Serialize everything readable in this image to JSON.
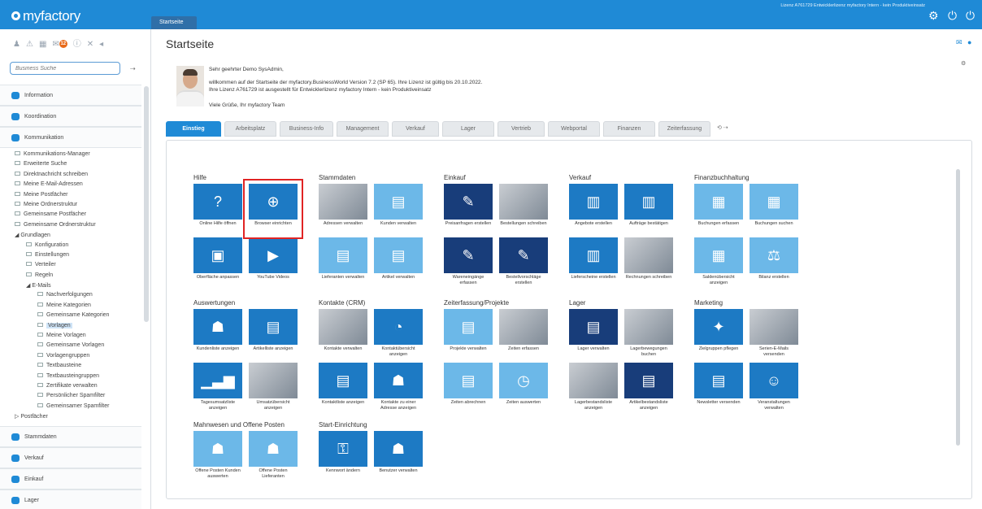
{
  "app": {
    "brand": "myfactory",
    "tab": "Startseite",
    "license": "Lizenz A761729 Entwicklerlizenz myfactory Intern - kein Produktiveinsatz",
    "icons": [
      "gear-icon",
      "power-icon",
      "power-alt-icon"
    ]
  },
  "sidebar": {
    "badge": "12",
    "search_placeholder": "Business Suche",
    "nav_top": [
      {
        "label": "Information"
      },
      {
        "label": "Koordination"
      },
      {
        "label": "Kommunikation"
      }
    ],
    "tree": [
      {
        "label": "Kommunikations-Manager",
        "lvl": 0
      },
      {
        "label": "Erweiterte Suche",
        "lvl": 0
      },
      {
        "label": "Direktnachricht schreiben",
        "lvl": 0
      },
      {
        "label": "Meine E-Mail-Adressen",
        "lvl": 0
      },
      {
        "label": "Meine Postfächer",
        "lvl": 0
      },
      {
        "label": "Meine Ordnerstruktur",
        "lvl": 0
      },
      {
        "label": "Gemeinsame Postfächer",
        "lvl": 0
      },
      {
        "label": "Gemeinsame Ordnerstruktur",
        "lvl": 0
      },
      {
        "label": "◢ Grundlagen",
        "lvl": 0,
        "folder": true
      },
      {
        "label": "Konfiguration",
        "lvl": 1
      },
      {
        "label": "Einstellungen",
        "lvl": 1
      },
      {
        "label": "Verteiler",
        "lvl": 1
      },
      {
        "label": "Regeln",
        "lvl": 1
      },
      {
        "label": "◢ E-Mails",
        "lvl": 1,
        "folder": true
      },
      {
        "label": "Nachverfolgungen",
        "lvl": 2
      },
      {
        "label": "Meine Kategorien",
        "lvl": 2
      },
      {
        "label": "Gemeinsame Kategorien",
        "lvl": 2
      },
      {
        "label": "Vorlagen",
        "lvl": 2,
        "sel": true
      },
      {
        "label": "Meine Vorlagen",
        "lvl": 2
      },
      {
        "label": "Gemeinsame Vorlagen",
        "lvl": 2
      },
      {
        "label": "Vorlagengruppen",
        "lvl": 2
      },
      {
        "label": "Textbausteine",
        "lvl": 2
      },
      {
        "label": "Textbausteingruppen",
        "lvl": 2
      },
      {
        "label": "Zertifikate verwalten",
        "lvl": 2
      },
      {
        "label": "Persönlicher Spamfilter",
        "lvl": 2
      },
      {
        "label": "Gemeinsamer Spamfilter",
        "lvl": 2
      },
      {
        "label": "▷ Postfächer",
        "lvl": 0,
        "folder": true
      }
    ],
    "nav_bottom": [
      {
        "label": "Stammdaten"
      },
      {
        "label": "Verkauf"
      },
      {
        "label": "Einkauf"
      },
      {
        "label": "Lager"
      }
    ]
  },
  "main": {
    "title": "Startseite",
    "welcome": [
      "Sehr geehrter Demo SysAdmin,",
      "willkommen auf der Startseite der myfactory.BusinessWorld Version 7.2 (SP 65). Ihre Lizenz ist gültig bis 20.10.2022.",
      "Ihre Lizenz A761729 ist ausgestellt für Entwicklerlizenz myfactory Intern - kein Produktiveinsatz",
      "Viele Grüße, Ihr myfactory Team"
    ],
    "tabs": [
      "Einstieg",
      "Arbeitsplatz",
      "Business-Info",
      "Management",
      "Verkauf",
      "Lager",
      "Vertrieb",
      "Webportal",
      "Finanzen",
      "Zeiterfassung"
    ],
    "sections": [
      {
        "title": "Hilfe",
        "col": 0,
        "row": 0,
        "tiles": [
          {
            "label": "Online Hilfe öffnen",
            "glyph": "?",
            "s": "dark"
          },
          {
            "label": "Browser einrichten",
            "glyph": "⊕",
            "s": "dark"
          },
          {
            "label": "Oberfläche anpassen",
            "glyph": "▣",
            "s": "dark"
          },
          {
            "label": "YouTube Videos",
            "glyph": "▶",
            "s": "dark"
          }
        ]
      },
      {
        "title": "Stammdaten",
        "col": 1,
        "row": 0,
        "tiles": [
          {
            "label": "Adressen verwalten",
            "glyph": "",
            "s": "photo"
          },
          {
            "label": "Kunden verwalten",
            "glyph": "▤",
            "s": "light"
          },
          {
            "label": "Lieferanten verwalten",
            "glyph": "▤",
            "s": "light"
          },
          {
            "label": "Artikel verwalten",
            "glyph": "▤",
            "s": "light"
          }
        ]
      },
      {
        "title": "Einkauf",
        "col": 2,
        "row": 0,
        "tiles": [
          {
            "label": "Preisanfragen erstellen",
            "glyph": "✎",
            "s": "navy"
          },
          {
            "label": "Bestellungen schreiben",
            "glyph": "",
            "s": "photo"
          },
          {
            "label": "Wareneingänge erfassen",
            "glyph": "✎",
            "s": "navy"
          },
          {
            "label": "Bestellvorschläge erstellen",
            "glyph": "✎",
            "s": "navy"
          }
        ]
      },
      {
        "title": "Verkauf",
        "col": 3,
        "row": 0,
        "tiles": [
          {
            "label": "Angebote erstellen",
            "glyph": "▥",
            "s": "dark"
          },
          {
            "label": "Aufträge bestätigen",
            "glyph": "▥",
            "s": "dark"
          },
          {
            "label": "Lieferscheine erstellen",
            "glyph": "▥",
            "s": "dark"
          },
          {
            "label": "Rechnungen schreiben",
            "glyph": "",
            "s": "photo"
          }
        ]
      },
      {
        "title": "Finanzbuchhaltung",
        "col": 4,
        "row": 0,
        "tiles": [
          {
            "label": "Buchungen erfassen",
            "glyph": "▦",
            "s": "light"
          },
          {
            "label": "Buchungen suchen",
            "glyph": "▦",
            "s": "light"
          },
          {
            "label": "Saldenübersicht anzeigen",
            "glyph": "▦",
            "s": "light"
          },
          {
            "label": "Bilanz erstellen",
            "glyph": "⚖",
            "s": "light"
          }
        ]
      },
      {
        "title": "Auswertungen",
        "col": 0,
        "row": 1,
        "tiles": [
          {
            "label": "Kundenliste anzeigen",
            "glyph": "☗",
            "s": "dark"
          },
          {
            "label": "Artikelliste anzeigen",
            "glyph": "▤",
            "s": "dark"
          },
          {
            "label": "Tagesumsatzliste anzeigen",
            "glyph": "▁▃▆",
            "s": "dark"
          },
          {
            "label": "Umsatzübersicht anzeigen",
            "glyph": "",
            "s": "photo"
          }
        ]
      },
      {
        "title": "Kontakte (CRM)",
        "col": 1,
        "row": 1,
        "tiles": [
          {
            "label": "Kontakte verwalten",
            "glyph": "",
            "s": "photo"
          },
          {
            "label": "Kontaktübersicht anzeigen",
            "glyph": "◔",
            "s": "dark"
          },
          {
            "label": "Kontaktliste anzeigen",
            "glyph": "▤",
            "s": "dark"
          },
          {
            "label": "Kontakte zu einer Adresse anzeigen",
            "glyph": "☗",
            "s": "dark"
          }
        ]
      },
      {
        "title": "Zeiterfassung/Projekte",
        "col": 2,
        "row": 1,
        "tiles": [
          {
            "label": "Projekte verwalten",
            "glyph": "▤",
            "s": "light"
          },
          {
            "label": "Zeiten erfassen",
            "glyph": "",
            "s": "photo"
          },
          {
            "label": "Zeiten abrechnen",
            "glyph": "▤",
            "s": "light"
          },
          {
            "label": "Zeiten auswerten",
            "glyph": "◷",
            "s": "light"
          }
        ]
      },
      {
        "title": "Lager",
        "col": 3,
        "row": 1,
        "tiles": [
          {
            "label": "Lager verwalten",
            "glyph": "▤",
            "s": "navy"
          },
          {
            "label": "Lagerbewegungen buchen",
            "glyph": "",
            "s": "photo"
          },
          {
            "label": "Lagerbestandsliste anzeigen",
            "glyph": "",
            "s": "photo"
          },
          {
            "label": "Artikelbestandsliste anzeigen",
            "glyph": "▤",
            "s": "navy"
          }
        ]
      },
      {
        "title": "Marketing",
        "col": 4,
        "row": 1,
        "tiles": [
          {
            "label": "Zielgruppen pflegen",
            "glyph": "✦",
            "s": "dark"
          },
          {
            "label": "Serien-E-Mails versenden",
            "glyph": "",
            "s": "photo"
          },
          {
            "label": "Newsletter versenden",
            "glyph": "▤",
            "s": "dark"
          },
          {
            "label": "Veranstaltungen verwalten",
            "glyph": "☺",
            "s": "dark"
          }
        ]
      },
      {
        "title": "Mahnwesen und Offene Posten",
        "col": 0,
        "row": 2,
        "tiles": [
          {
            "label": "Offene Posten Kunden auswerten",
            "glyph": "☗",
            "s": "light"
          },
          {
            "label": "Offene Posten Lieferanten",
            "glyph": "☗",
            "s": "light"
          }
        ]
      },
      {
        "title": "Start-Einrichtung",
        "col": 1,
        "row": 2,
        "tiles": [
          {
            "label": "Kennwort ändern",
            "glyph": "⚿",
            "s": "dark"
          },
          {
            "label": "Benutzer verwalten",
            "glyph": "☗",
            "s": "dark"
          }
        ]
      }
    ]
  }
}
